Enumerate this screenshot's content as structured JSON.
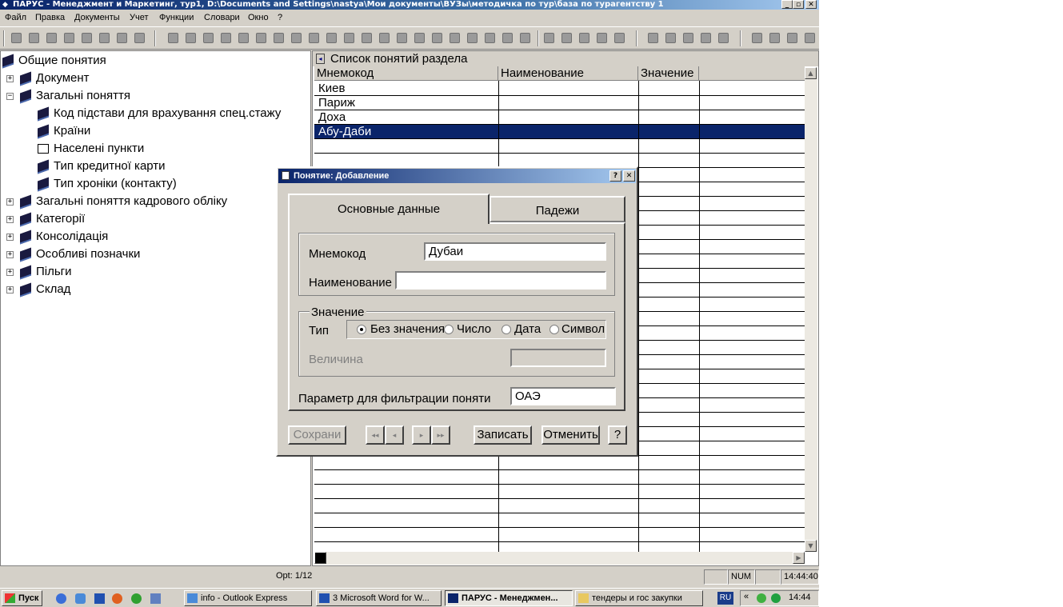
{
  "window": {
    "title": "ПАРУС - Менеджмент и Маркетинг, тур1, D:\\Documents and Settings\\nastya\\Мои документы\\ВУЗы\\методичка по тур\\база по турагентству 1",
    "minimize": "_",
    "maximize": "▫",
    "close": "✕"
  },
  "menu": [
    "Файл",
    "Правка",
    "Документы",
    "Учет",
    "Функции",
    "Словари",
    "Окно",
    "?"
  ],
  "tree": {
    "root": "Общие понятия",
    "nodes": [
      {
        "label": "Документ"
      },
      {
        "label": "Загальні поняття"
      },
      {
        "label": "Код підстави для врахування спец.стажу"
      },
      {
        "label": "Країни"
      },
      {
        "label": "Населені пункти"
      },
      {
        "label": "Тип кредитної карти"
      },
      {
        "label": "Тип хроніки (контакту)"
      },
      {
        "label": "Загальні поняття кадрового обліку"
      },
      {
        "label": "Категорії"
      },
      {
        "label": "Консолідація"
      },
      {
        "label": "Особливі позначки"
      },
      {
        "label": "Пільги"
      },
      {
        "label": "Склад"
      }
    ]
  },
  "grid": {
    "title": "Список понятий раздела",
    "columns": [
      "Мнемокод",
      "Наименование",
      "Значение"
    ],
    "rows": [
      {
        "code": "Киев"
      },
      {
        "code": "Париж"
      },
      {
        "code": "Доха"
      },
      {
        "code": "Абу-Даби"
      }
    ]
  },
  "dialog": {
    "title": "Понятие: Добавление",
    "help_btn": "?",
    "close_btn": "✕",
    "tabs": [
      "Основные данные",
      "Падежи"
    ],
    "fields": {
      "mnemo_label": "Мнемокод",
      "mnemo_value": "Дубаи",
      "name_label": "Наименование",
      "name_value": ""
    },
    "value_group": {
      "title": "Значение",
      "type_label": "Тип",
      "options": [
        "Без значения",
        "Число",
        "Дата",
        "Символ"
      ],
      "selected": "Без значения",
      "magnitude_label": "Величина",
      "magnitude_value": ""
    },
    "filter_label": "Параметр для фильтрации поняти",
    "filter_value": "ОАЭ",
    "buttons": {
      "save": "Сохрани",
      "first": "◂◂",
      "prev": "◂",
      "next": "▸",
      "last": "▸▸",
      "write": "Записать",
      "cancel": "Отменить",
      "help": "?"
    }
  },
  "status": {
    "record": "Орt: 1/12",
    "num": "NUM",
    "time": "14:44:40"
  },
  "taskbar": {
    "start": "Пуск",
    "tasks": [
      {
        "label": "info - Outlook Express"
      },
      {
        "label": "3 Microsoft Word for W..."
      },
      {
        "label": "ПАРУС - Менеджмен..."
      },
      {
        "label": "тендеры и гос закупки"
      }
    ],
    "lang": "RU",
    "clock": "14:44"
  }
}
